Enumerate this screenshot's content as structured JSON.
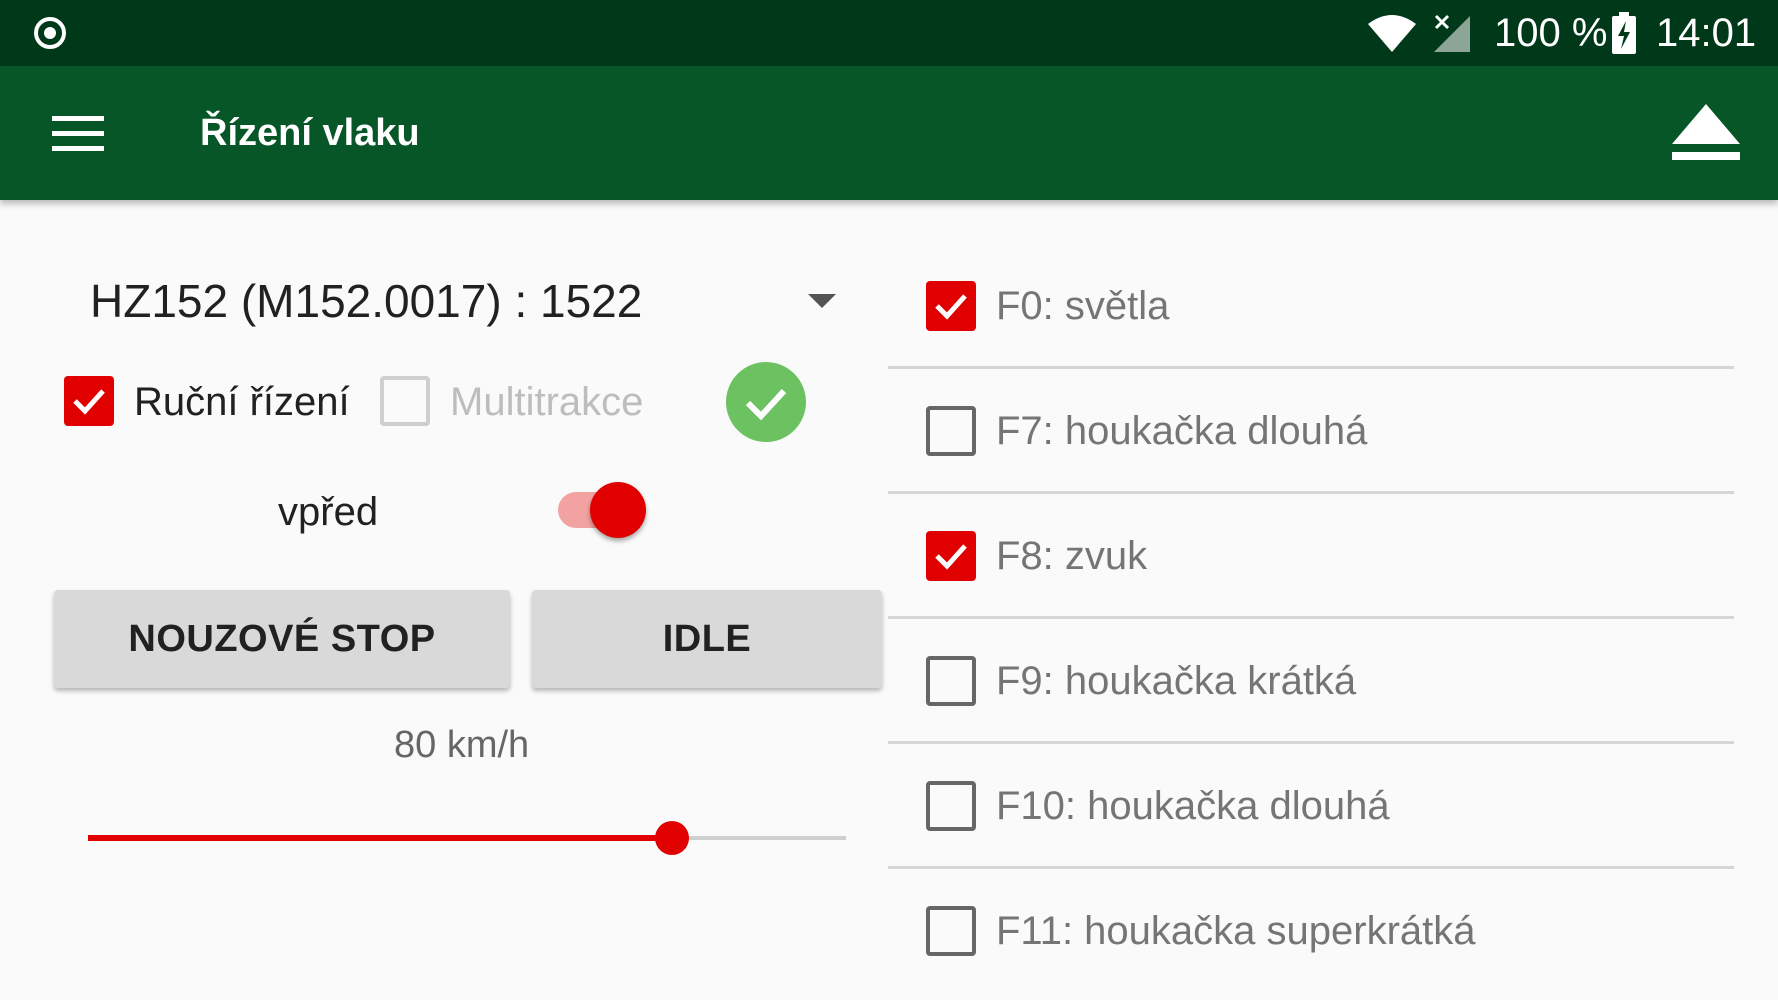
{
  "status_bar": {
    "left_icon": "target-circle-icon",
    "battery_text": "100 %",
    "time": "14:01",
    "icons": [
      "wifi-icon",
      "signal-no-service-icon",
      "battery-charging-icon"
    ]
  },
  "app_bar": {
    "title": "Řízení vlaku",
    "menu_icon": "hamburger-menu-icon",
    "action_icon": "eject-icon"
  },
  "controls": {
    "loco_select": "HZ152 (M152.0017) : 1522",
    "manual_control": {
      "label": "Ruční řízení",
      "checked": true
    },
    "multitraction": {
      "label": "Multitrakce",
      "checked": false,
      "enabled": false
    },
    "status_icon": "check-circle-icon",
    "direction": {
      "label": "vpřed",
      "on": true
    },
    "emergency_stop_label": "NOUZOVÉ STOP",
    "idle_label": "IDLE",
    "speed_text": "80 km/h",
    "speed_fraction": 0.77
  },
  "functions": [
    {
      "label": "F0: světla",
      "checked": true
    },
    {
      "label": "F7: houkačka dlouhá",
      "checked": false
    },
    {
      "label": "F8: zvuk",
      "checked": true
    },
    {
      "label": "F9: houkačka krátká",
      "checked": false
    },
    {
      "label": "F10: houkačka dlouhá",
      "checked": false
    },
    {
      "label": "F11: houkačka superkrátká",
      "checked": false
    }
  ],
  "colors": {
    "status_bar": "#00391a",
    "app_bar": "#065628",
    "accent": "#e00000",
    "ok_green": "#6cc160"
  }
}
